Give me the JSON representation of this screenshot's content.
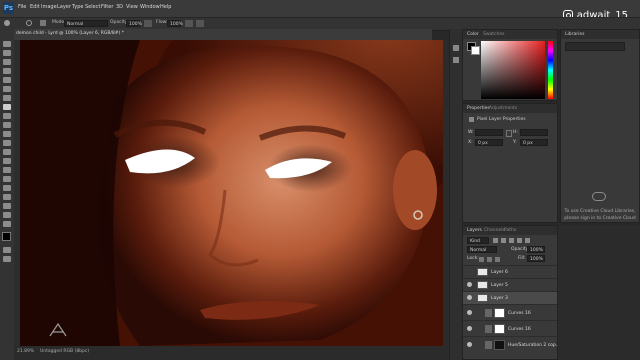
{
  "app": {
    "logo": "Ps"
  },
  "menu": [
    "File",
    "Edit",
    "Image",
    "Layer",
    "Type",
    "Select",
    "Filter",
    "3D",
    "View",
    "Window",
    "Help"
  ],
  "watermark": "adwait_15",
  "options_bar": {
    "mode_label": "Mode:",
    "mode_value": "Normal",
    "opacity_label": "Opacity:",
    "opacity_value": "100%",
    "flow_label": "Flow:",
    "flow_value": "100%"
  },
  "document": {
    "tab_title": "demon child - Lyrd @ 100% (Layer 6, RGB/8#) *"
  },
  "status_bar": {
    "zoom": "21.89%",
    "doc_info": "Untagged RGB (8bpc)"
  },
  "color_panel": {
    "tabs": [
      "Color",
      "Swatches"
    ],
    "hue_accent": "#e82020"
  },
  "libraries_panel": {
    "tab": "Libraries",
    "message_line1": "To use Creative Cloud Libraries,",
    "message_line2": "please sign in to Creative Cloud"
  },
  "properties_panel": {
    "tabs": [
      "Properties",
      "Adjustments"
    ],
    "section": "Pixel Layer Properties",
    "w_label": "W:",
    "h_label": "H:",
    "x_label": "X:",
    "y_label": "Y:",
    "x_value": "0 px",
    "y_value": "0 px"
  },
  "layers_panel": {
    "tabs": [
      "Layers",
      "Channels",
      "Paths"
    ],
    "filter_label": "Kind",
    "blend_mode": "Normal",
    "opacity_label": "Opacity:",
    "opacity_value": "100%",
    "lock_label": "Lock:",
    "fill_label": "Fill:",
    "fill_value": "100%",
    "layers": [
      {
        "name": "Layer 6"
      },
      {
        "name": "Layer 5"
      },
      {
        "name": "Layer 3"
      },
      {
        "name": "Curves 16"
      },
      {
        "name": "Curves 16"
      },
      {
        "name": "Hue/Saturation 2 cop..."
      }
    ]
  }
}
